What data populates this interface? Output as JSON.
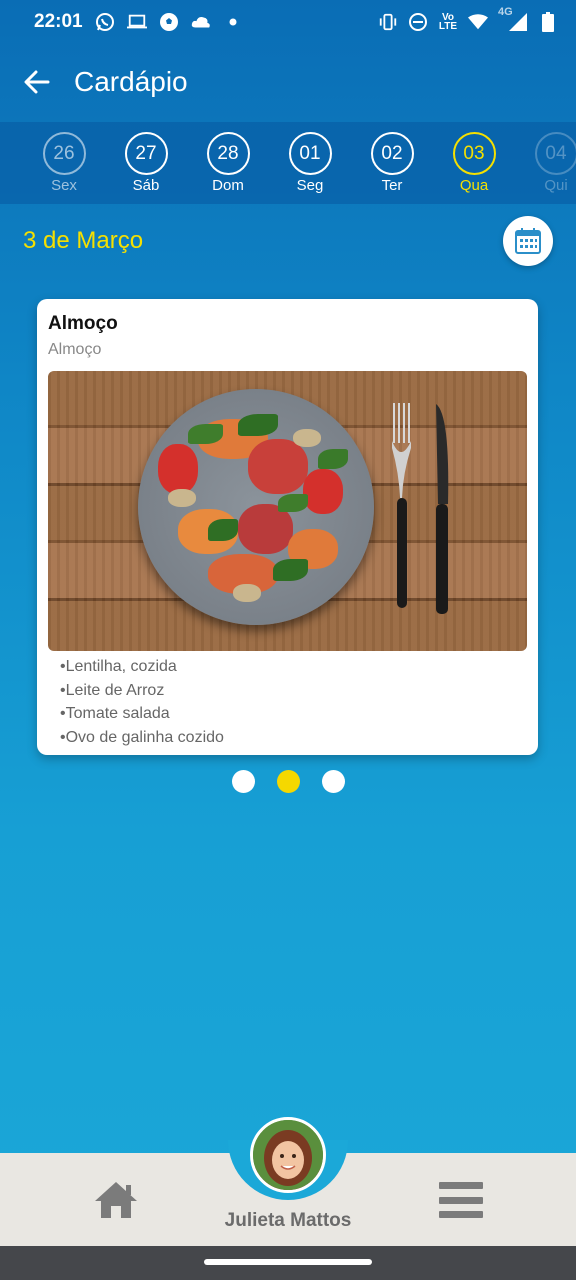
{
  "status_bar": {
    "time": "22:01",
    "net_label_top": "Vo",
    "net_label_bottom": "LTE",
    "signal_label": "4G"
  },
  "app_bar": {
    "title": "Cardápio"
  },
  "days": [
    {
      "num": "26",
      "label": "Sex",
      "state": "dim"
    },
    {
      "num": "27",
      "label": "Sáb",
      "state": "normal"
    },
    {
      "num": "28",
      "label": "Dom",
      "state": "normal"
    },
    {
      "num": "01",
      "label": "Seg",
      "state": "normal"
    },
    {
      "num": "02",
      "label": "Ter",
      "state": "normal"
    },
    {
      "num": "03",
      "label": "Qua",
      "state": "active"
    },
    {
      "num": "04",
      "label": "Qui",
      "state": "faded"
    }
  ],
  "date_title": "3 de Março",
  "meal": {
    "title": "Almoço",
    "subtitle": "Almoço",
    "ingredients": [
      "•Lentilha, cozida",
      "•Leite de Arroz",
      "•Tomate salada",
      "•Ovo de galinha cozido"
    ]
  },
  "pager": {
    "count": 3,
    "active_index": 1
  },
  "bottom_nav": {
    "user_name": "Julieta Mattos"
  },
  "colors": {
    "accent_yellow": "#f5e000",
    "bar_blue": "#0a6db5",
    "nav_bg": "#e9e7e2"
  }
}
